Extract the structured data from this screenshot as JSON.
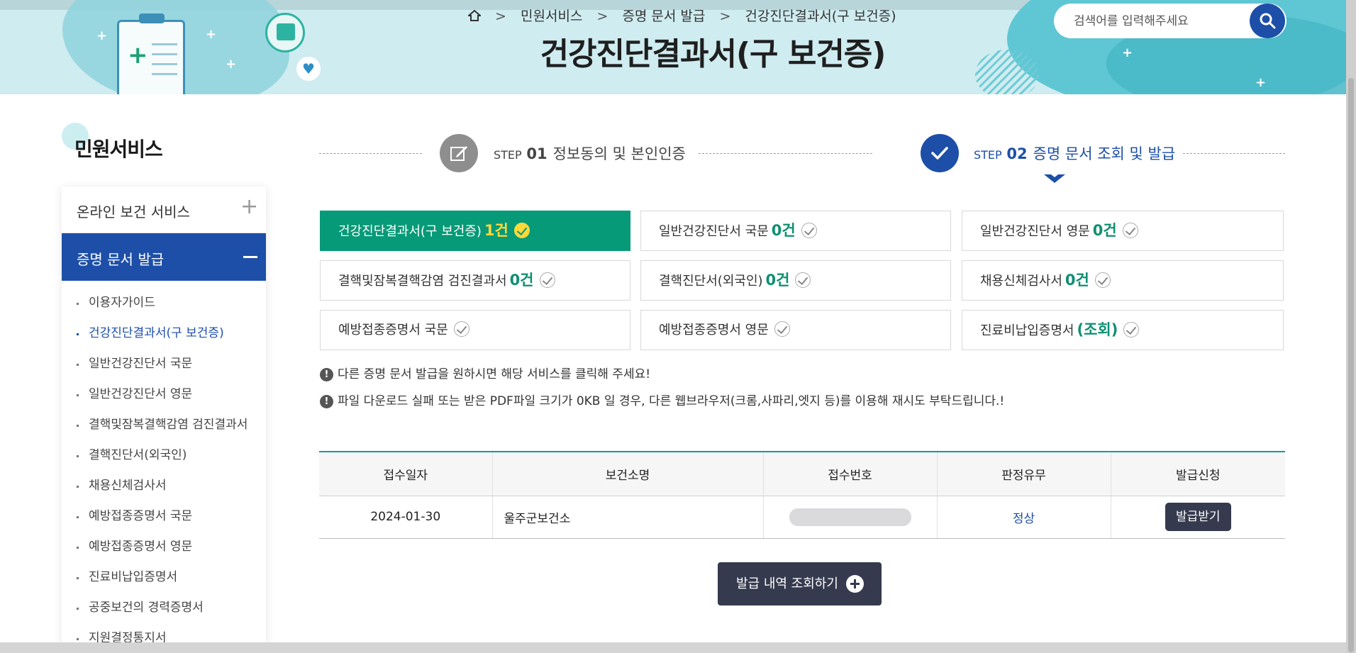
{
  "header": {
    "breadcrumb": [
      "민원서비스",
      "증명 문서 발급",
      "건강진단결과서(구 보건증)"
    ],
    "title": "건강진단결과서(구 보건증)",
    "search_placeholder": "검색어를 입력해주세요"
  },
  "sidebar": {
    "title": "민원서비스",
    "menus": [
      {
        "label": "온라인 보건 서비스",
        "expanded": false
      },
      {
        "label": "증명 문서 발급",
        "expanded": true
      }
    ],
    "items": [
      "이용자가이드",
      "건강진단결과서(구 보건증)",
      "일반건강진단서 국문",
      "일반건강진단서 영문",
      "결핵및잠복결핵감염 검진결과서",
      "결핵진단서(외국인)",
      "채용신체검사서",
      "예방접종증명서 국문",
      "예방접종증명서 영문",
      "진료비납입증명서",
      "공중보건의 경력증명서",
      "지원결정통지서"
    ],
    "current_index": 1
  },
  "steps": [
    {
      "word": "STEP",
      "num": "01",
      "label": "정보동의 및 본인인증",
      "icon": "edit-icon",
      "color": "#8e8e8e"
    },
    {
      "word": "STEP",
      "num": "02",
      "label": "증명 문서 조회 및 발급",
      "icon": "check-icon",
      "color": "#1d4fa8"
    }
  ],
  "documents": [
    {
      "label": "건강진단결과서(구 보건증)",
      "count": "1건",
      "active": true
    },
    {
      "label": "일반건강진단서 국문",
      "count": "0건"
    },
    {
      "label": "일반건강진단서 영문",
      "count": "0건"
    },
    {
      "label": "결핵및잠복결핵감염 검진결과서",
      "count": "0건"
    },
    {
      "label": "결핵진단서(외국인)",
      "count": "0건"
    },
    {
      "label": "채용신체검사서",
      "count": "0건"
    },
    {
      "label": "예방접종증명서 국문",
      "count": ""
    },
    {
      "label": "예방접종증명서 영문",
      "count": ""
    },
    {
      "label": "진료비납입증명서",
      "count": "(조회)"
    }
  ],
  "notices": [
    "다른 증명 문서 발급을 원하시면 해당 서비스를 클릭해 주세요!",
    "파일 다운로드 실패 또는 받은 PDF파일 크기가 0KB 일 경우, 다른 웹브라우저(크롬,사파리,엣지 등)를 이용해 재시도 부탁드립니다.!"
  ],
  "table": {
    "headers": [
      "접수일자",
      "보건소명",
      "접수번호",
      "판정유무",
      "발급신청"
    ],
    "rows": [
      {
        "date": "2024-01-30",
        "center": "울주군보건소",
        "receipt_no": "",
        "status": "정상",
        "action": "발급받기"
      }
    ]
  },
  "history_button": "발급 내역 조회하기",
  "colors": {
    "primary": "#1d4fa8",
    "active_green": "#069a78",
    "dark_button": "#353a4e",
    "count_green": "#0f8f73"
  }
}
